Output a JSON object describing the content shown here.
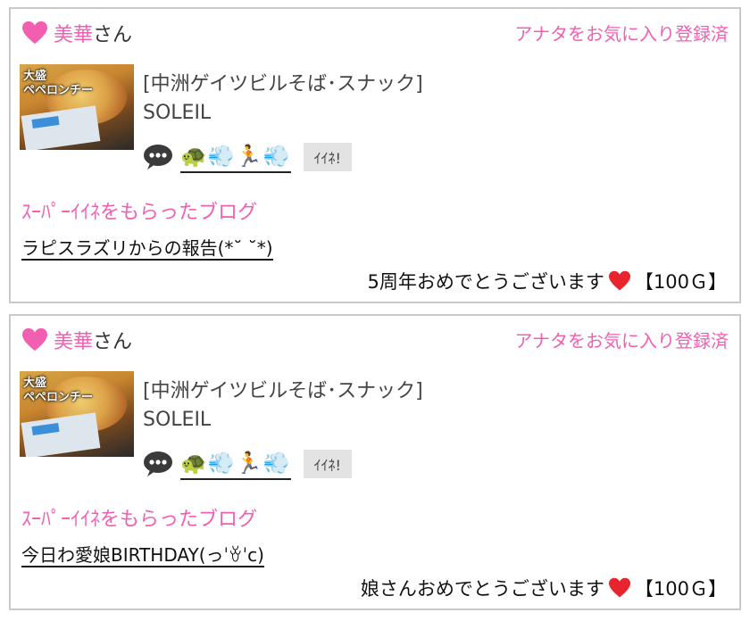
{
  "colors": {
    "accent_pink": "#f25fb1",
    "border": "#c9c9c9",
    "button_bg": "#e3e3e3"
  },
  "cards": [
    {
      "user_name": "美華",
      "san": "さん",
      "favorite_status": "アナタをお気に入り登録済",
      "thumbnail_text": "大盛\nペペロンチーノ",
      "category": "[中洲ゲイツビルそば･スナック]",
      "shop_name": "SOLEIL",
      "emoji_row": "🐢💨🏃💨",
      "ii_button": "ｲｲﾈ!",
      "blog_label": "ｽｰﾊﾟｰｲｲﾈをもらったブログ",
      "blog_title": "ラピスラズリからの報告(*˘ ˘*)",
      "message": "5周年おめでとうございます",
      "gift": "【100Ｇ】"
    },
    {
      "user_name": "美華",
      "san": "さん",
      "favorite_status": "アナタをお気に入り登録済",
      "thumbnail_text": "大盛\nペペロンチーノ",
      "category": "[中洲ゲイツビルそば･スナック]",
      "shop_name": "SOLEIL",
      "emoji_row": "🐢💨🏃💨",
      "ii_button": "ｲｲﾈ!",
      "blog_label": "ｽｰﾊﾟｰｲｲﾈをもらったブログ",
      "blog_title": "今日わ愛娘BIRTHDAY(っˈꈊˈc)",
      "message": "娘さんおめでとうございます",
      "gift": "【100Ｇ】"
    }
  ]
}
